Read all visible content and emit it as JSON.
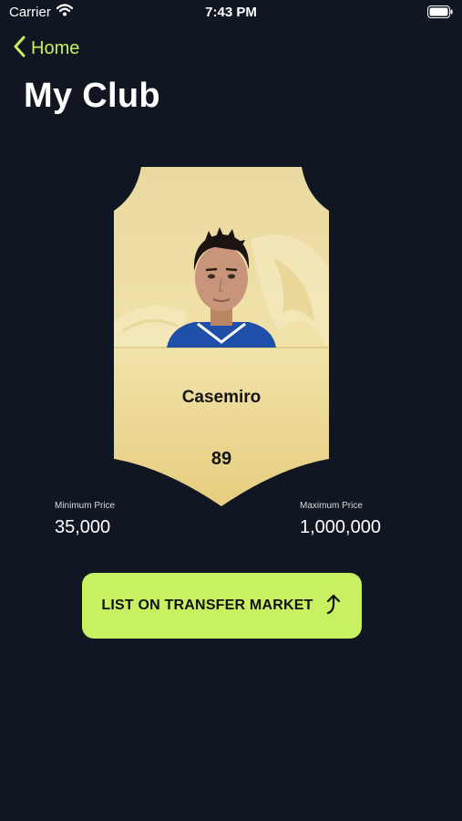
{
  "status_bar": {
    "carrier": "Carrier",
    "time": "7:43 PM"
  },
  "nav": {
    "back_label": "Home"
  },
  "page_title": "My Club",
  "player": {
    "name": "Casemiro",
    "rating": "89"
  },
  "prices": {
    "minimum": {
      "label": "Minimum Price",
      "value": "35,000"
    },
    "maximum": {
      "label": "Maximum Price",
      "value": "1,000,000"
    }
  },
  "actions": {
    "list_button_label": "LIST ON TRANSFER MARKET"
  },
  "colors": {
    "background": "#111722",
    "accent": "#c8f060",
    "card_gold": "#e8d08a"
  }
}
